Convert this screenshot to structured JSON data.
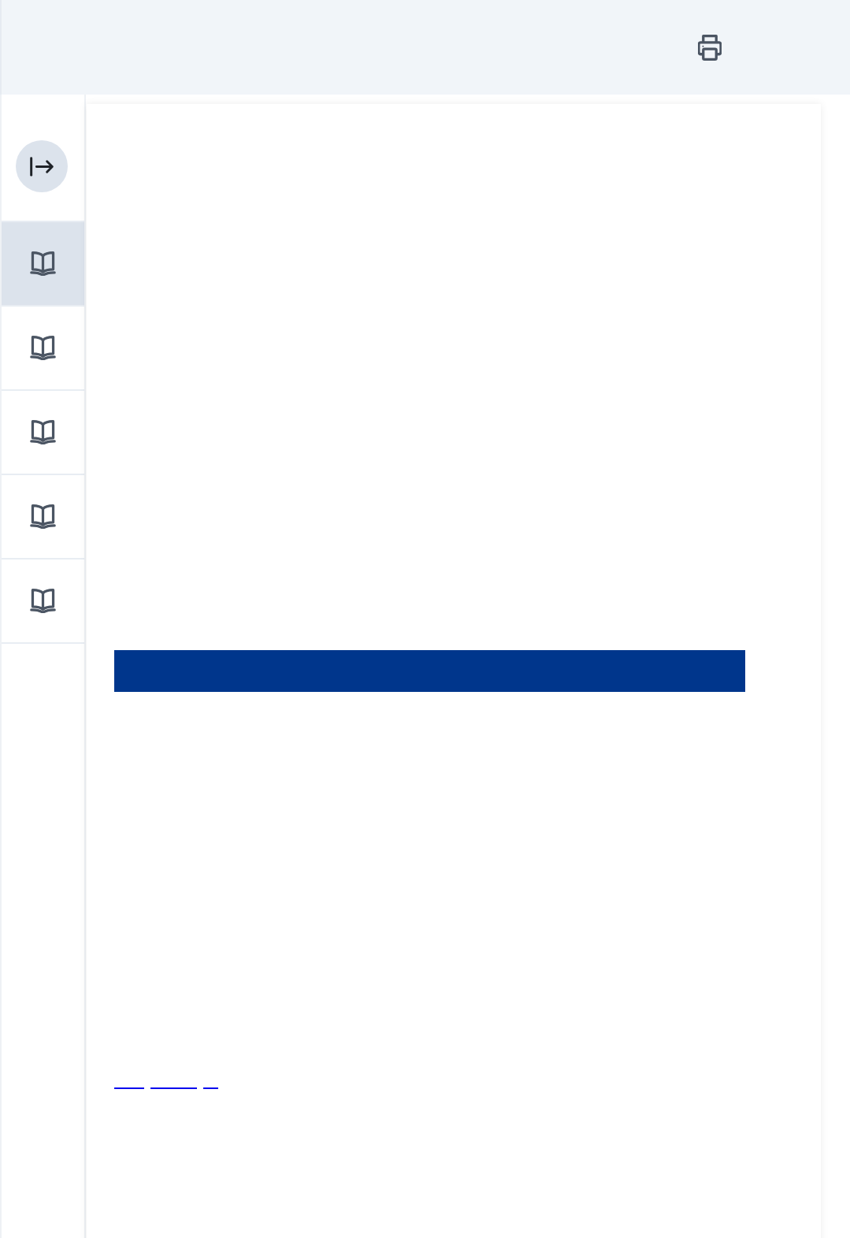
{
  "sidebar": {
    "expanded": false,
    "items": [
      {
        "selected": true
      },
      {
        "selected": false
      },
      {
        "selected": false
      },
      {
        "selected": false
      },
      {
        "selected": false
      }
    ]
  }
}
